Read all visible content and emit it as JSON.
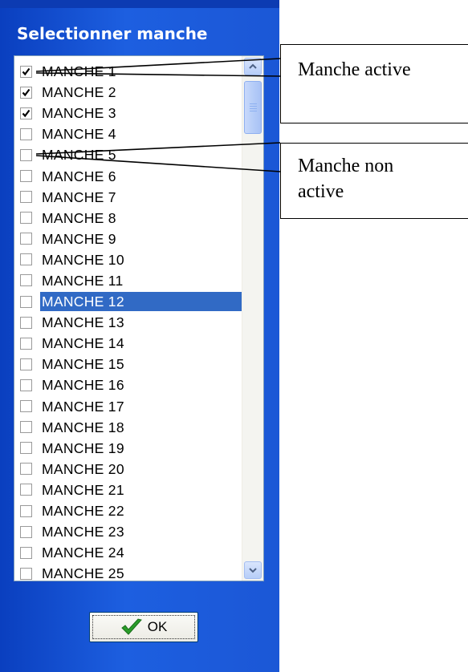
{
  "dialog": {
    "title": "Selectionner manche",
    "ok_label": "OK"
  },
  "list": {
    "items": [
      {
        "label": "MANCHE 1",
        "checked": true
      },
      {
        "label": "MANCHE 2",
        "checked": true
      },
      {
        "label": "MANCHE 3",
        "checked": true
      },
      {
        "label": "MANCHE 4",
        "checked": false
      },
      {
        "label": "MANCHE 5",
        "checked": false
      },
      {
        "label": "MANCHE 6",
        "checked": false
      },
      {
        "label": "MANCHE 7",
        "checked": false
      },
      {
        "label": "MANCHE 8",
        "checked": false
      },
      {
        "label": "MANCHE 9",
        "checked": false
      },
      {
        "label": "MANCHE 10",
        "checked": false
      },
      {
        "label": "MANCHE 11",
        "checked": false
      },
      {
        "label": "MANCHE 12",
        "checked": false,
        "selected": true
      },
      {
        "label": "MANCHE 13",
        "checked": false
      },
      {
        "label": "MANCHE 14",
        "checked": false
      },
      {
        "label": "MANCHE 15",
        "checked": false
      },
      {
        "label": "MANCHE 16",
        "checked": false
      },
      {
        "label": "MANCHE 17",
        "checked": false
      },
      {
        "label": "MANCHE 18",
        "checked": false
      },
      {
        "label": "MANCHE 19",
        "checked": false
      },
      {
        "label": "MANCHE 20",
        "checked": false
      },
      {
        "label": "MANCHE 21",
        "checked": false
      },
      {
        "label": "MANCHE 22",
        "checked": false
      },
      {
        "label": "MANCHE 23",
        "checked": false
      },
      {
        "label": "MANCHE 24",
        "checked": false
      },
      {
        "label": "MANCHE 25",
        "checked": false
      }
    ]
  },
  "callouts": {
    "active": "Manche active",
    "inactive_line1": "Manche non",
    "inactive_line2": "active"
  },
  "colors": {
    "dialog_blue": "#1b57d6",
    "selection": "#316ac5",
    "ok_check": "#2a9d2a"
  },
  "icons": {
    "checkbox_check": "check-mark-icon",
    "ok": "green-check-icon",
    "scroll_up": "chevron-up-icon",
    "scroll_down": "chevron-down-icon"
  }
}
